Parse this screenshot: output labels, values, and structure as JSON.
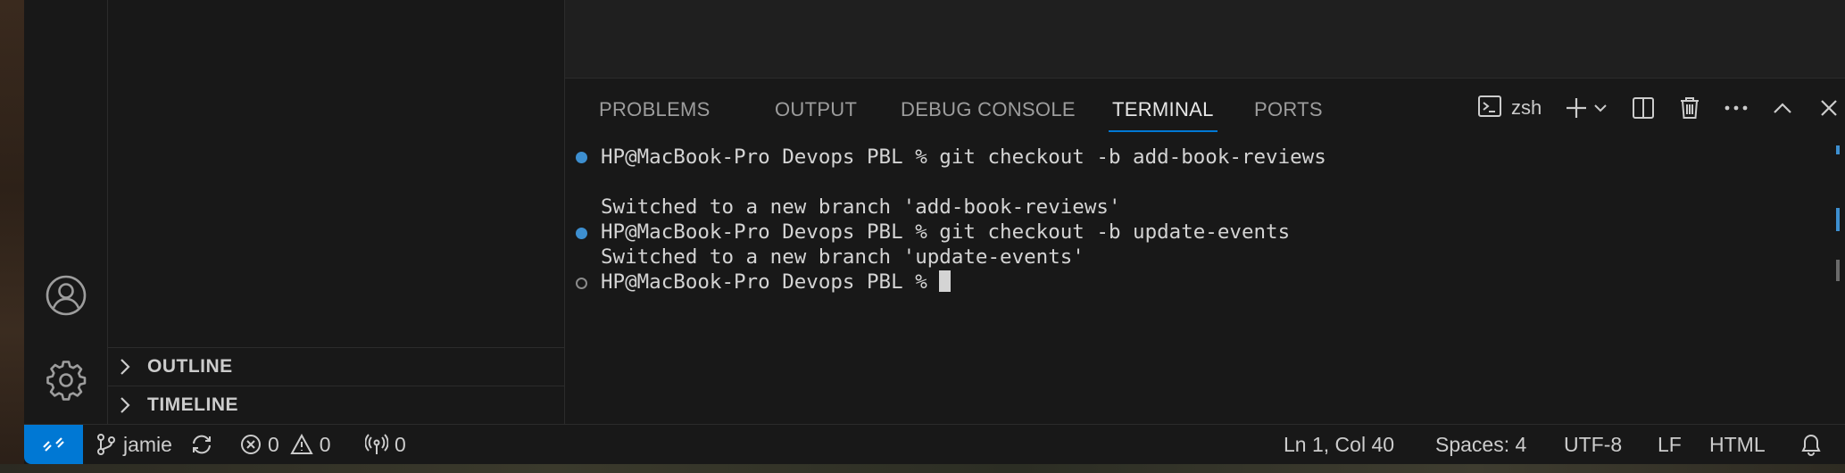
{
  "activity_bar": {
    "icons": [
      "account-icon",
      "settings-gear-icon"
    ]
  },
  "sidebar": {
    "sections": [
      {
        "label": "OUTLINE",
        "expanded": false
      },
      {
        "label": "TIMELINE",
        "expanded": false
      }
    ]
  },
  "panel": {
    "tabs": [
      {
        "label": "PROBLEMS",
        "active": false
      },
      {
        "label": "OUTPUT",
        "active": false
      },
      {
        "label": "DEBUG CONSOLE",
        "active": false
      },
      {
        "label": "TERMINAL",
        "active": true
      },
      {
        "label": "PORTS",
        "active": false
      }
    ],
    "terminal_profile": "zsh",
    "actions": [
      "new-terminal-icon",
      "chevron-down-icon",
      "split-terminal-icon",
      "trash-icon",
      "ellipsis-icon",
      "maximize-panel-icon",
      "close-icon"
    ]
  },
  "terminal": {
    "lines": [
      {
        "decoration": "success",
        "text": "HP@MacBook-Pro Devops PBL % git checkout -b add-book-reviews"
      },
      {
        "decoration": "none",
        "text": ""
      },
      {
        "decoration": "none",
        "text": "Switched to a new branch 'add-book-reviews'"
      },
      {
        "decoration": "success",
        "text": "HP@MacBook-Pro Devops PBL % git checkout -b update-events"
      },
      {
        "decoration": "none",
        "text": "Switched to a new branch 'update-events'"
      },
      {
        "decoration": "idle",
        "text": "HP@MacBook-Pro Devops PBL % "
      }
    ]
  },
  "status_bar": {
    "branch": "jamie",
    "errors": "0",
    "warnings": "0",
    "ports": "0",
    "cursor_position": "Ln 1, Col 40",
    "indentation": "Spaces: 4",
    "encoding": "UTF-8",
    "eol": "LF",
    "language": "HTML"
  },
  "colors": {
    "accent": "#0078d4",
    "background": "#181818",
    "terminal_text": "#d4d4d4",
    "success_dot": "#3d8fd0"
  }
}
